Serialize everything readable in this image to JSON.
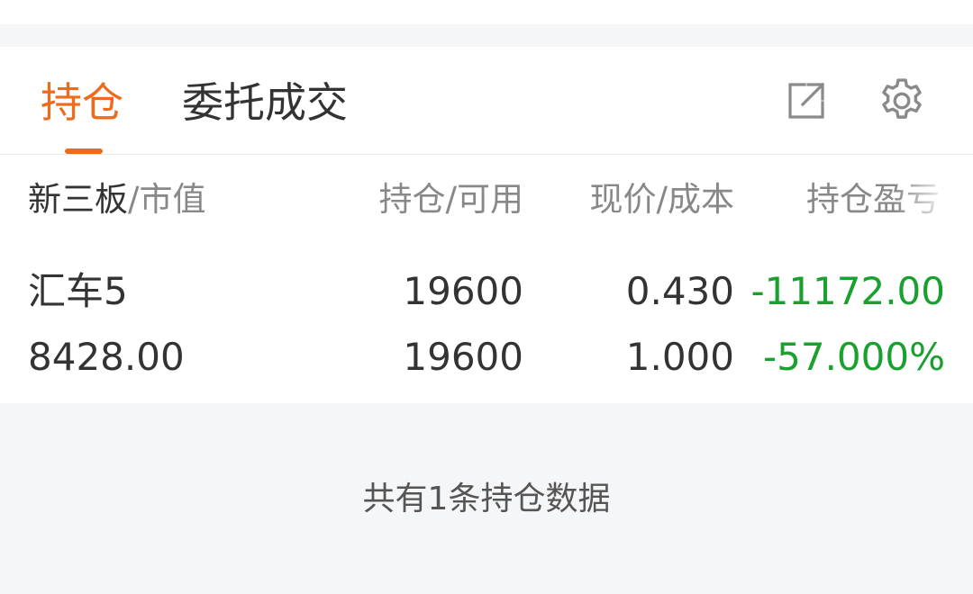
{
  "theme": {
    "accent": "#ee6a1d",
    "gain_loss": "#1aa02e",
    "text": "#333333",
    "muted": "#888888"
  },
  "tabs": {
    "positions_label": "持仓",
    "orders_label": "委托成交"
  },
  "toolbar": {
    "share_icon": "external-link-icon",
    "settings_icon": "gear-icon"
  },
  "header": {
    "board": "新三板",
    "market_value": "/市值",
    "hold_available": "持仓/可用",
    "price_cost": "现价/成本",
    "position_pl": "持仓盈亏"
  },
  "positions": [
    {
      "name": "汇车5",
      "market_value": "8428.00",
      "holding": "19600",
      "available": "19600",
      "current_price": "0.430",
      "cost": "1.000",
      "pl_amount": "-11172.00",
      "pl_percent": "-57.000%"
    }
  ],
  "footer": {
    "summary": "共有1条持仓数据"
  }
}
